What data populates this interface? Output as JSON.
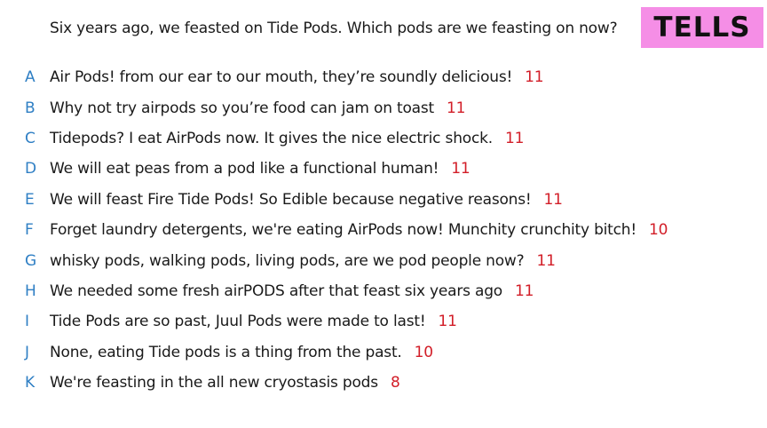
{
  "question": "Six years ago, we feasted on Tide Pods. Which pods are we feasting on now?",
  "badge": "TELLS",
  "colors": {
    "letter": "#2f7fc4",
    "count": "#d21e28",
    "badge_bg": "#f58ee6"
  },
  "answers": [
    {
      "letter": "A",
      "text": "Air Pods! from our ear to our mouth, they’re soundly delicious!",
      "count": "11"
    },
    {
      "letter": "B",
      "text": "Why not try airpods so you’re food can jam on toast",
      "count": "11"
    },
    {
      "letter": "C",
      "text": "Tidepods? I eat AirPods now. It gives the nice electric shock.",
      "count": "11"
    },
    {
      "letter": "D",
      "text": "We will eat peas from a pod like a functional human!",
      "count": "11"
    },
    {
      "letter": "E",
      "text": "We will feast Fire Tide Pods! So Edible because negative reasons!",
      "count": "11"
    },
    {
      "letter": "F",
      "text": "Forget laundry detergents, we're eating AirPods now! Munchity crunchity bitch!",
      "count": "10"
    },
    {
      "letter": "G",
      "text": "whisky pods, walking pods, living pods, are we pod people now?",
      "count": "11"
    },
    {
      "letter": "H",
      "text": "We needed some fresh airPODS after that feast six years ago",
      "count": "11"
    },
    {
      "letter": "I",
      "text": "Tide Pods are so past, Juul Pods were made to last!",
      "count": "11"
    },
    {
      "letter": "J",
      "text": "None, eating Tide pods is a thing from the past.",
      "count": "10"
    },
    {
      "letter": "K",
      "text": "We're feasting in the all new cryostasis pods",
      "count": "8"
    }
  ]
}
